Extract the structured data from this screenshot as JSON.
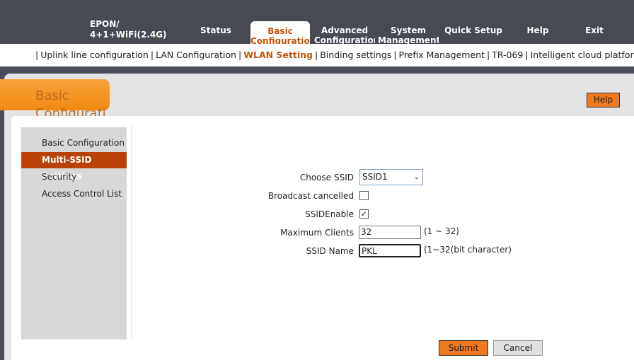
{
  "header": {
    "brand_line1": "EPON/",
    "brand_line2": "4+1+WiFi(2.4G)",
    "tabs": [
      {
        "line1": "Status",
        "line2": ""
      },
      {
        "line1": "Basic",
        "line2": "Configuration"
      },
      {
        "line1": "Advanced",
        "line2": "Configuration"
      },
      {
        "line1": "System",
        "line2": "Management"
      },
      {
        "line1": "Quick Setup",
        "line2": ""
      },
      {
        "line1": "Help",
        "line2": ""
      },
      {
        "line1": "Exit",
        "line2": ""
      }
    ]
  },
  "subnav": {
    "items": [
      "Uplink line configuration",
      "LAN Configuration",
      "WLAN Setting",
      "Binding settings",
      "Prefix Management",
      "TR-069",
      "Intelligent cloud platform"
    ],
    "separator": "|"
  },
  "section": {
    "title": "Basic Configurati",
    "help_label": "Help"
  },
  "sidebar": {
    "items": [
      "Basic Configuration",
      "Multi-SSID Settings",
      "Security",
      "Access Control List"
    ]
  },
  "form": {
    "choose_ssid_label": "Choose SSID",
    "choose_ssid_value": "SSID1",
    "broadcast_label": "Broadcast cancelled",
    "broadcast_checked": false,
    "ssid_enable_label": "SSIDEnable",
    "ssid_enable_checked": true,
    "check_mark": "✓",
    "max_clients_label": "Maximum Clients",
    "max_clients_value": "32",
    "max_clients_hint": "(1 ~ 32)",
    "ssid_name_label": "SSID Name",
    "ssid_name_value": "PKL",
    "ssid_name_hint": "(1~32(bit character)",
    "submit_label": "Submit",
    "cancel_label": "Cancel"
  },
  "colors": {
    "accent": "#f07a22",
    "active_text": "#c2560b",
    "sidebar_active": "#b84207"
  }
}
